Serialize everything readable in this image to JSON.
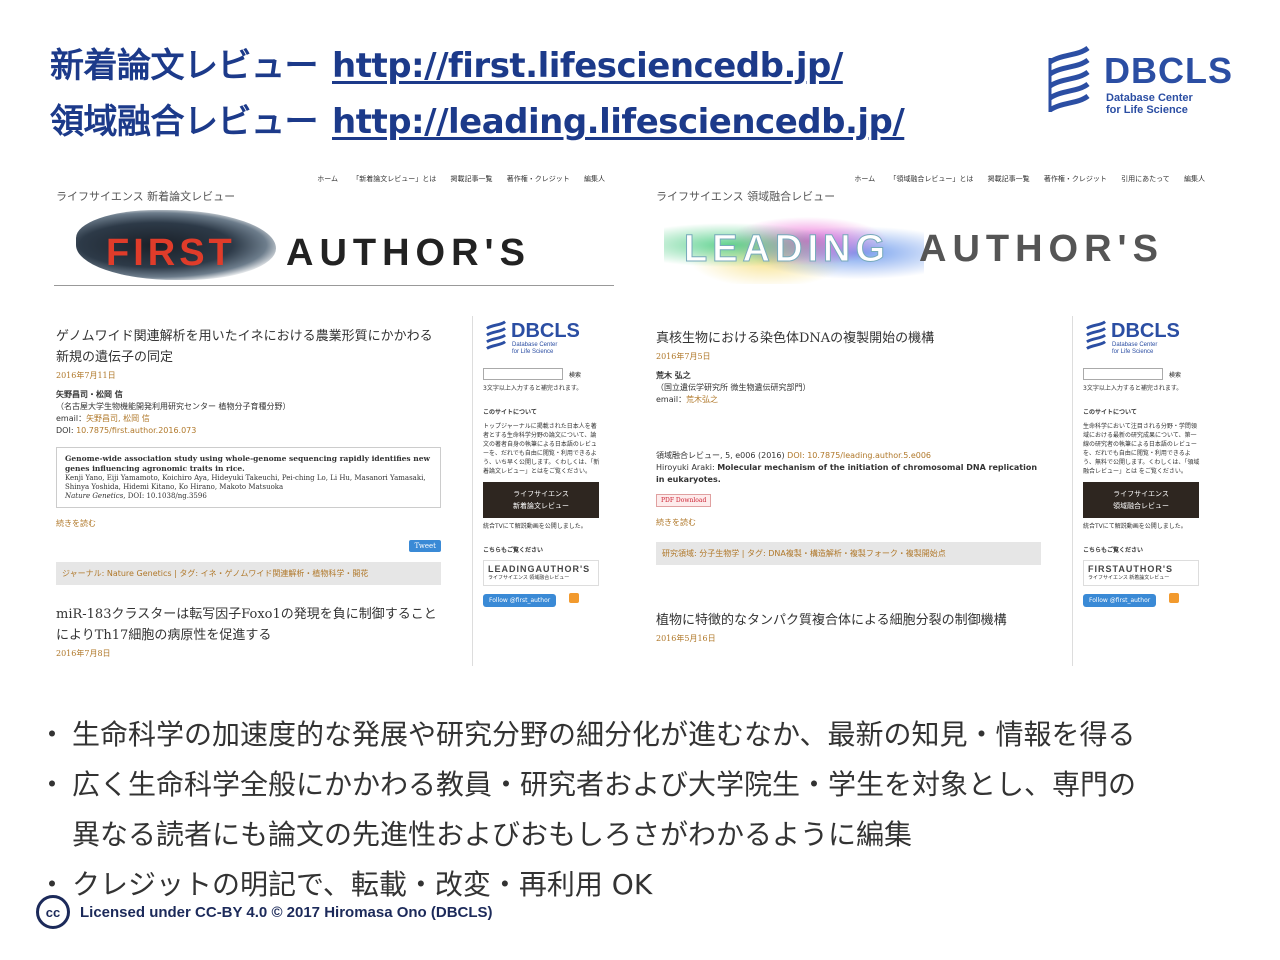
{
  "title": {
    "line1_label": "新着論文レビュー",
    "line1_url": "http://first.lifesciencedb.jp/",
    "line2_label": "領域融合レビュー",
    "line2_url": "http://leading.lifesciencedb.jp/"
  },
  "logo": {
    "name": "DBCLS",
    "sub_line1": "Database Center",
    "sub_line2": "for Life Science"
  },
  "first_site": {
    "nav": [
      "ホーム",
      "「新着論文レビュー」とは",
      "掲載記事一覧",
      "著作権・クレジット",
      "編集人"
    ],
    "site_name": "ライフサイエンス 新着論文レビュー",
    "banner_red": "FIRST",
    "banner_dark": "AUTHOR'S",
    "article1": {
      "title": "ゲノムワイド関連解析を用いたイネにおける農業形質にかかわる新規の遺伝子の同定",
      "date": "2016年7月11日",
      "authors": "矢野昌司・松岡 信",
      "affiliation": "（名古屋大学生物機能開発利用研究センター 植物分子育種分野）",
      "email_label": "email：",
      "email_names": "矢野昌司, 松岡 信",
      "doi_label": "DOI:",
      "doi": "10.7875/first.author.2016.073",
      "ref_title": "Genome-wide association study using whole-genome sequencing rapidly identifies new genes influencing agronomic traits in rice.",
      "ref_authors": "Kenji Yano, Eiji Yamamoto, Koichiro Aya, Hideyuki Takeuchi, Pei-ching Lo, Li Hu, Masanori Yamasaki, Shinya Yoshida, Hidemi Kitano, Ko Hirano, Makoto Matsuoka",
      "ref_journal": "Nature Genetics",
      "ref_doi": ", DOI: 10.1038/ng.3596",
      "more": "続きを読む",
      "tweet": "Tweet",
      "tags": "ジャーナル: Nature Genetics | タグ: イネ・ゲノムワイド関連解析・植物科学・開花"
    },
    "article2": {
      "title": "miR-183クラスターは転写因子Foxo1の発現を負に制御することによりTh17細胞の病原性を促進する",
      "date": "2016年7月8日"
    },
    "sidebar": {
      "search_btn": "検索",
      "search_note": "3文字以上入力すると補完されます。",
      "about_hd": "このサイトについて",
      "about_text": "トップジャーナルに掲載された日本人を著者とする生命科学分野の論文について、論文の著者自身の執筆による日本語のレビューを、だれでも自由に閲覧・利用できるよう、いち早く公開します。くわしくは、「新着論文レビュー」とはをご覧ください。",
      "promo_line1": "ライフサイエンス",
      "promo_line2": "新着論文レビュー",
      "promo_note": "統合TVにて解説動画を公開しました。",
      "see_also": "こちらもご覧ください",
      "mini_title": "LEADINGAUTHOR'S",
      "mini_caption": "ライフサイエンス 領域融合レビュー",
      "follow": "Follow @first_author"
    }
  },
  "leading_site": {
    "nav": [
      "ホーム",
      "「領域融合レビュー」とは",
      "掲載記事一覧",
      "著作権・クレジット",
      "引用にあたって",
      "編集人"
    ],
    "site_name": "ライフサイエンス 領域融合レビュー",
    "banner_light": "LEADING",
    "banner_dark": "AUTHOR'S",
    "article1": {
      "title": "真核生物における染色体DNAの複製開始の機構",
      "date": "2016年7月5日",
      "authors": "荒木 弘之",
      "affiliation": "（国立遺伝学研究所 微生物遺伝研究部門）",
      "email_label": "email：",
      "email_names": "荒木弘之",
      "ref_line": "領域融合レビュー, 5, e006 (2016)",
      "ref_doi": "DOI: 10.7875/leading.author.5.e006",
      "ref_author": "Hiroyuki Araki:",
      "ref_title": "Molecular mechanism of the initiation of chromosomal DNA replication in eukaryotes.",
      "pdf": "PDF Download",
      "more": "続きを読む",
      "tags": "研究領域: 分子生物学 | タグ: DNA複製・構造解析・複製フォーク・複製開始点"
    },
    "article2": {
      "title": "植物に特徴的なタンパク質複合体による細胞分裂の制御機構",
      "date": "2016年5月16日"
    },
    "sidebar": {
      "search_btn": "検索",
      "search_note": "3文字以上入力すると補完されます。",
      "about_hd": "このサイトについて",
      "about_text": "生命科学において注目される分野・学問領域における最新の研究成果について、第一線の研究者の執筆による日本語のレビューを、だれでも自由に閲覧・利用できるよう、無料で公開します。くわしくは、「領域融合レビュー」とは をご覧ください。",
      "promo_line1": "ライフサイエンス",
      "promo_line2": "領域融合レビュー",
      "promo_note": "統合TVにて解説動画を公開しました。",
      "see_also": "こちらもご覧ください",
      "mini_title": "FIRSTAUTHOR'S",
      "mini_caption": "ライフサイエンス 新着論文レビュー",
      "follow": "Follow @first_author"
    }
  },
  "bullets": [
    "生命科学の加速度的な発展や研究分野の細分化が進むなか、最新の知見・情報を得る",
    "広く生命科学全般にかかわる教員・研究者および大学院生・学生を対象とし、専門の",
    "異なる読者にも論文の先進性およびおもしろさがわかるように編集",
    "クレジットの明記で、転載・改変・再利用 OK"
  ],
  "bullet_mark": "・",
  "footer": {
    "cc_label": "cc",
    "license": "Licensed under CC-BY 4.0 © 2017 Hiromasa Ono (DBCLS)"
  },
  "colors": {
    "title_blue": "#1c3a8a",
    "logo_blue": "#2b4ea3",
    "link_brown": "#b0782a",
    "first_red": "#e03c2a"
  }
}
